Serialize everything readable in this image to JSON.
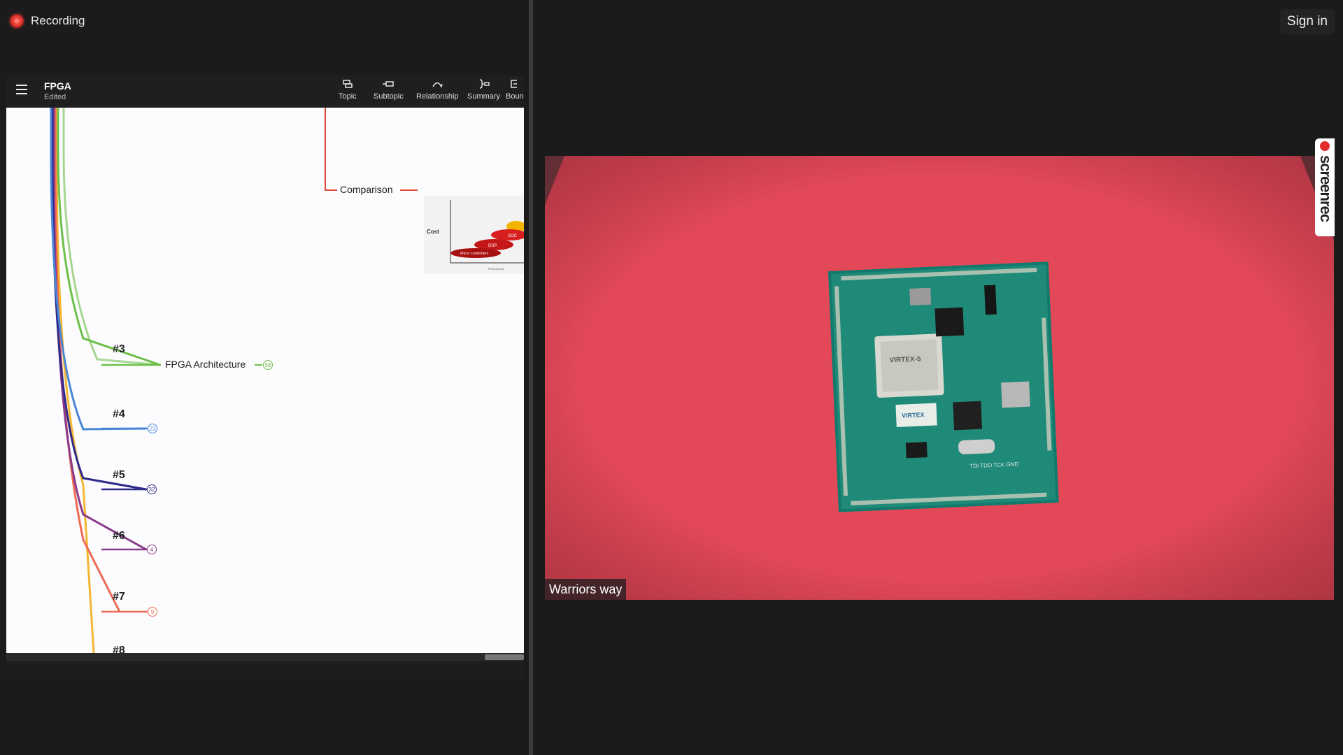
{
  "recording": {
    "label": "Recording"
  },
  "header": {
    "sign_in": "Sign in"
  },
  "app": {
    "title": "FPGA",
    "status": "Edited",
    "toolbar": [
      {
        "label": "Topic",
        "icon": "topic-icon"
      },
      {
        "label": "Subtopic",
        "icon": "subtopic-icon"
      },
      {
        "label": "Relationship",
        "icon": "relationship-icon"
      },
      {
        "label": "Summary",
        "icon": "summary-icon"
      },
      {
        "label": "Boun",
        "icon": "boundary-icon"
      }
    ]
  },
  "mindmap": {
    "comparison_label": "Comparison",
    "chart": {
      "y_label": "Cost",
      "x_label": "Performance",
      "tags": [
        "Micro controllers",
        "DSP",
        "SOC"
      ]
    },
    "branches": [
      {
        "tag": "#3",
        "label": "FPGA Architecture",
        "count": "58",
        "color": "#6cc04a"
      },
      {
        "tag": "#4",
        "label": "",
        "count": "23",
        "color": "#4a86d6"
      },
      {
        "tag": "#5",
        "label": "",
        "count": "32",
        "color": "#2f2a8a"
      },
      {
        "tag": "#6",
        "label": "",
        "count": "4",
        "color": "#8a3a8c"
      },
      {
        "tag": "#7",
        "label": "",
        "count": "9",
        "color": "#f06a52"
      },
      {
        "tag": "#8",
        "label": "",
        "count": "",
        "color": "#f4b731"
      }
    ]
  },
  "video": {
    "participant_name": "Warriors way",
    "board_markings": [
      "VIRTEX-5",
      "VIRTEX",
      "TDI TDO TCK GND"
    ]
  },
  "watermark": {
    "text": "screenrec"
  },
  "colors": {
    "record_red": "#e8423a",
    "mindmap_red": "#e04a3c",
    "video_bg": "#e5475a",
    "pcb_green": "#1f8a78"
  }
}
